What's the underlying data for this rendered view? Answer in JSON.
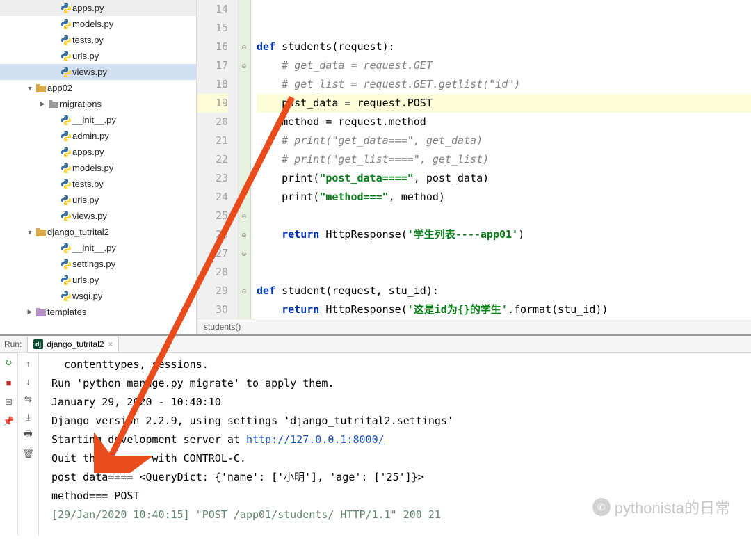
{
  "sidebar": {
    "items": [
      {
        "label": "apps.py",
        "type": "py",
        "indent": 4
      },
      {
        "label": "models.py",
        "type": "py",
        "indent": 4
      },
      {
        "label": "tests.py",
        "type": "py",
        "indent": 4
      },
      {
        "label": "urls.py",
        "type": "py",
        "indent": 4
      },
      {
        "label": "views.py",
        "type": "py",
        "indent": 4,
        "selected": true
      },
      {
        "label": "app02",
        "type": "folder",
        "indent": 2,
        "expanded": true
      },
      {
        "label": "migrations",
        "type": "folder-grey",
        "indent": 3,
        "expanded": false
      },
      {
        "label": "__init__.py",
        "type": "py",
        "indent": 4
      },
      {
        "label": "admin.py",
        "type": "py",
        "indent": 4
      },
      {
        "label": "apps.py",
        "type": "py",
        "indent": 4
      },
      {
        "label": "models.py",
        "type": "py",
        "indent": 4
      },
      {
        "label": "tests.py",
        "type": "py",
        "indent": 4
      },
      {
        "label": "urls.py",
        "type": "py",
        "indent": 4
      },
      {
        "label": "views.py",
        "type": "py",
        "indent": 4
      },
      {
        "label": "django_tutrital2",
        "type": "folder",
        "indent": 2,
        "expanded": true
      },
      {
        "label": "__init__.py",
        "type": "py",
        "indent": 4
      },
      {
        "label": "settings.py",
        "type": "py",
        "indent": 4
      },
      {
        "label": "urls.py",
        "type": "py",
        "indent": 4
      },
      {
        "label": "wsgi.py",
        "type": "py",
        "indent": 4
      },
      {
        "label": "templates",
        "type": "folder-purple",
        "indent": 2
      }
    ]
  },
  "editor": {
    "lines": [
      {
        "n": 14,
        "t": "plain",
        "text": ""
      },
      {
        "n": 15,
        "t": "plain",
        "text": ""
      },
      {
        "n": 16,
        "t": "def1",
        "kw1": "def",
        "name": " students(request):"
      },
      {
        "n": 17,
        "t": "comment",
        "text": "    # get_data = request.GET"
      },
      {
        "n": 18,
        "t": "comment",
        "text": "    # get_list = request.GET.getlist(\"id\")"
      },
      {
        "n": 19,
        "t": "plain",
        "text": "    post_data = request.POST",
        "hl": true
      },
      {
        "n": 20,
        "t": "plain",
        "text": "    method = request.method"
      },
      {
        "n": 21,
        "t": "comment",
        "text": "    # print(\"get_data===\", get_data)"
      },
      {
        "n": 22,
        "t": "comment",
        "text": "    # print(\"get_list====\", get_list)"
      },
      {
        "n": 23,
        "t": "print",
        "pre": "    print(",
        "str": "\"post_data====\"",
        "post": ", post_data)"
      },
      {
        "n": 24,
        "t": "print",
        "pre": "    print(",
        "str": "\"method===\"",
        "post": ", method)"
      },
      {
        "n": 25,
        "t": "plain",
        "text": ""
      },
      {
        "n": 26,
        "t": "return",
        "pre": "    ",
        "kw": "return",
        "mid": " HttpResponse(",
        "str": "'学生列表----app01'",
        "post": ")"
      },
      {
        "n": 27,
        "t": "plain",
        "text": ""
      },
      {
        "n": 28,
        "t": "plain",
        "text": ""
      },
      {
        "n": 29,
        "t": "def2",
        "kw1": "def",
        "name": " student(request, stu_id):"
      },
      {
        "n": 30,
        "t": "return",
        "pre": "    ",
        "kw": "return",
        "mid": " HttpResponse(",
        "str": "'这是id为{}的学生'",
        "post": ".format(stu_id))"
      }
    ],
    "breadcrumb": "students()"
  },
  "run": {
    "label": "Run:",
    "tab": "django_tutrital2",
    "console": [
      {
        "t": "p",
        "text": "  contenttypes, sessions."
      },
      {
        "t": "p",
        "text": "Run 'python manage.py migrate' to apply them."
      },
      {
        "t": "p",
        "text": "January 29, 2020 - 10:40:10"
      },
      {
        "t": "p",
        "text": "Django version 2.2.9, using settings 'django_tutrital2.settings'"
      },
      {
        "t": "link",
        "pre": "Starting development server at ",
        "url": "http://127.0.0.1:8000/"
      },
      {
        "t": "p",
        "text": "Quit the server with CONTROL-C."
      },
      {
        "t": "p",
        "text": "post_data==== <QueryDict: {'name': ['小明'], 'age': ['25']}>"
      },
      {
        "t": "p",
        "text": "method=== POST"
      },
      {
        "t": "log",
        "text": "[29/Jan/2020 10:40:15] \"POST /app01/students/ HTTP/1.1\" 200 21"
      }
    ]
  },
  "watermark": "pythonista的日常"
}
